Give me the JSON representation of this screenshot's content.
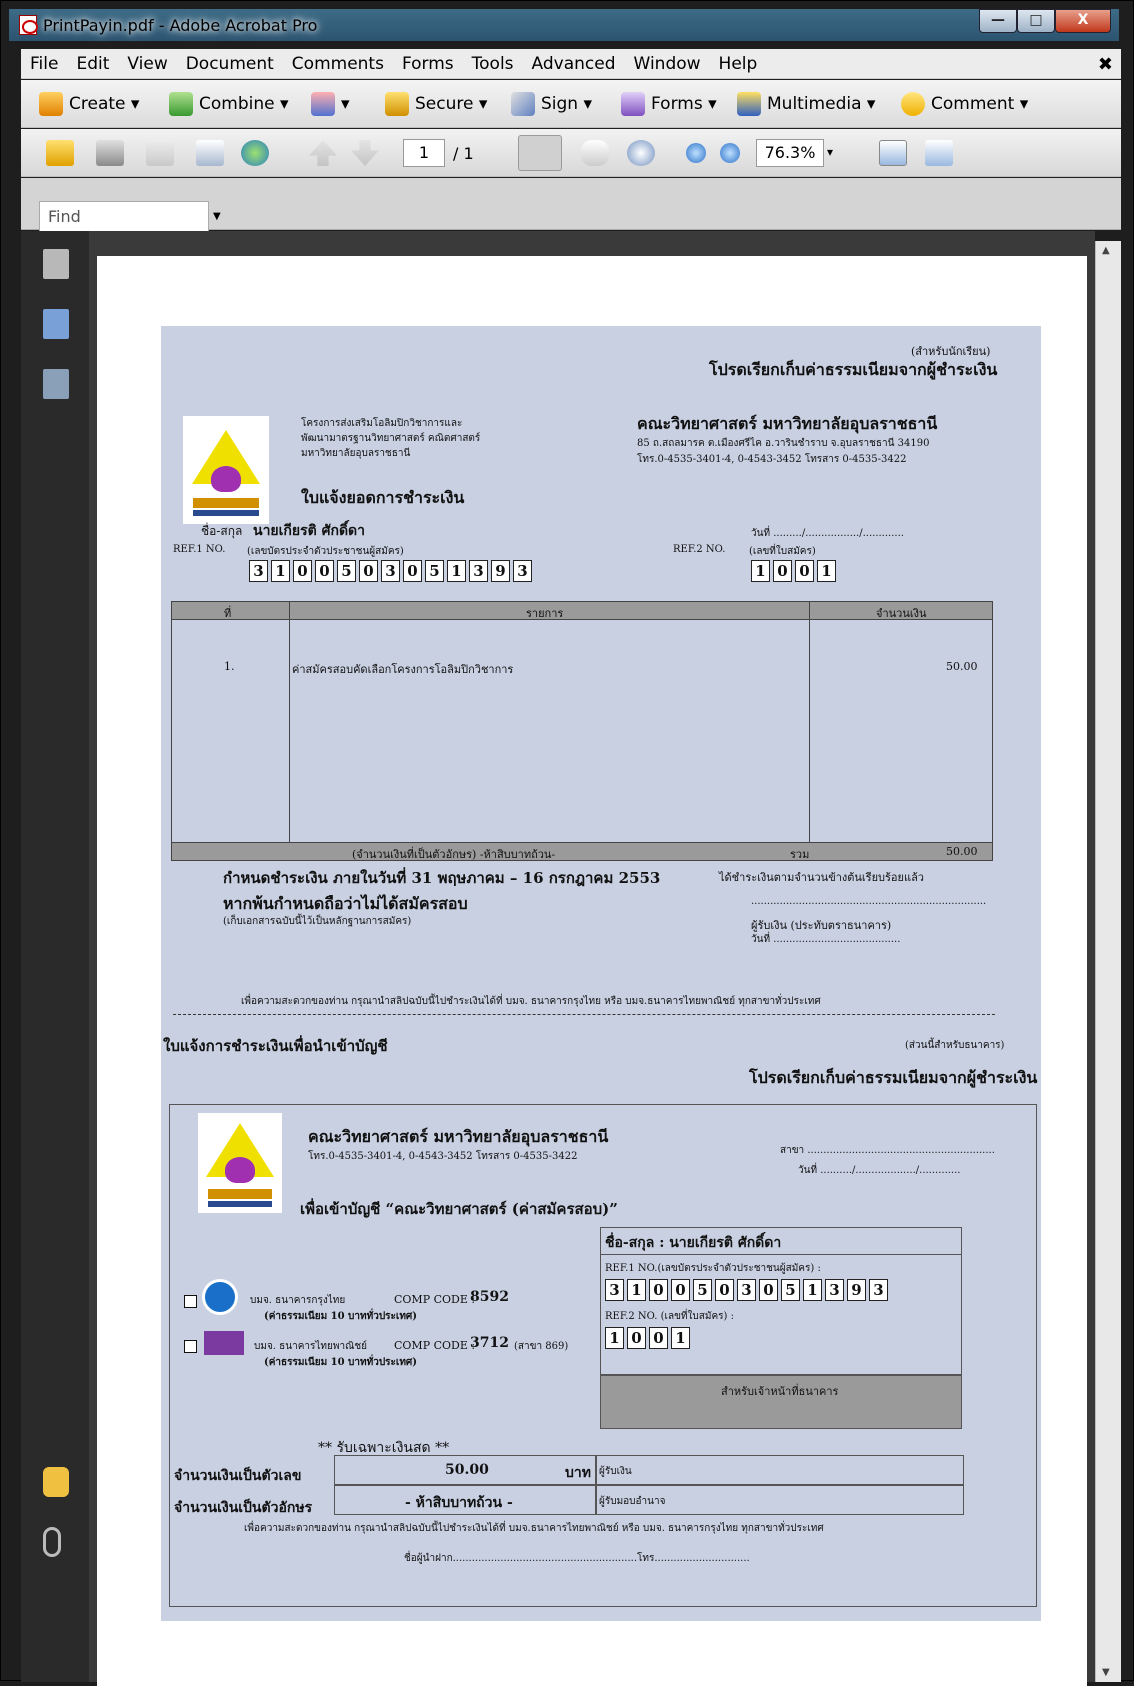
{
  "window": {
    "title": "PrintPayin.pdf - Adobe Acrobat Pro",
    "min_glyph": "—",
    "max_glyph": "□",
    "close_glyph": "X"
  },
  "menubar": {
    "items": [
      "File",
      "Edit",
      "View",
      "Document",
      "Comments",
      "Forms",
      "Tools",
      "Advanced",
      "Window",
      "Help"
    ],
    "close_glyph": "✖"
  },
  "toolbar1": {
    "create": "Create",
    "combine": "Combine",
    "secure": "Secure",
    "sign": "Sign",
    "forms": "Forms",
    "multimedia": "Multimedia",
    "comment": "Comment",
    "dropdown_glyph": "▾"
  },
  "toolbar2": {
    "page_current": "1",
    "page_total": "/ 1",
    "zoom": "76.3%",
    "zoom_dropdown": "▾"
  },
  "find": {
    "placeholder": "Find",
    "dropdown_glyph": "▼"
  },
  "scroll": {
    "up": "▲",
    "down": "▼"
  },
  "doc": {
    "top_copy_label": "(สำหรับนักเรียน)",
    "top_collect": "โปรดเรียกเก็บค่าธรรมเนียมจากผู้ชำระเงิน",
    "project_line1": "โครงการส่งเสริมโอลิมปิกวิชาการและ",
    "project_line2": "พัฒนามาตรฐานวิทยาศาสตร์ คณิตศาสตร์",
    "project_line3": "มหาวิทยาลัยอุบลราชธานี",
    "faculty": "คณะวิทยาศาสตร์ มหาวิทยาลัยอุบลราชธานี",
    "address": "85 ถ.สถลมารค ต.เมืองศรีไค อ.วารินชำราบ จ.อุบลราชธานี 34190",
    "phone": "โทร.0-4535-3401-4, 0-4543-3452 โทรสาร 0-4535-3422",
    "slip_title": "ใบแจ้งยอดการชำระเงิน",
    "name_label": "ชื่อ-สกุล",
    "name_value": "นายเกียรติ ศักดิ์ดา",
    "date_label": "วันที่ ........./................./.............",
    "ref1_label": "REF.1 NO.",
    "ref1_note": "(เลขบัตรประจำตัวประชาชนผู้สมัคร)",
    "ref2_label": "REF.2 NO.",
    "ref2_note": "(เลขที่ใบสมัคร)",
    "ref1_digits": [
      "3",
      "1",
      "0",
      "0",
      "5",
      "0",
      "3",
      "0",
      "5",
      "1",
      "3",
      "9",
      "3"
    ],
    "ref2_digits": [
      "1",
      "0",
      "0",
      "1"
    ],
    "table": {
      "headers": [
        "ที่",
        "รายการ",
        "จำนวนเงิน"
      ],
      "rows": [
        {
          "no": "1.",
          "item": "ค่าสมัครสอบคัดเลือกโครงการโอลิมปิกวิชาการ",
          "amount": "50.00"
        }
      ],
      "words_label": "(จำนวนเงินที่เป็นตัวอักษร) -ห้าสิบบาทถ้วน-",
      "total_label": "รวม",
      "total_value": "50.00"
    },
    "deadline": "กำหนดชำระเงิน ภายในวันที่ 31 พฤษภาคม – 16 กรกฎาคม 2553",
    "paid_note": "ได้ชำระเงินตามจำนวนข้างต้นเรียบร้อยแล้ว",
    "late_note": "หากพ้นกำหนดถือว่าไม่ได้สมัครสอบ",
    "keep_note": "(เก็บเอกสารฉบับนี้ไว้เป็นหลักฐานการสมัคร)",
    "sign_line": "..........................................................................",
    "receiver": "ผู้รับเงิน (ประทับตราธนาคาร)",
    "receiver_date": "วันที่ ........................................",
    "convenience_top": "เพื่อความสะดวกของท่าน กรุณานำสลิปฉบับนี้ไปชำระเงินได้ที่ บมจ. ธนาคารกรุงไทย หรือ บมจ.ธนาคารไทยพาณิชย์ ทุกสาขาทั่วประเทศ",
    "bank_slip_title": "ใบแจ้งการชำระเงินเพื่อนำเข้าบัญชี",
    "bank_copy_label": "(ส่วนนี้สำหรับธนาคาร)",
    "bank_collect": "โปรดเรียกเก็บค่าธรรมเนียมจากผู้ชำระเงิน",
    "branch_label": "สาขา ...........................................................",
    "bank_date": "วันที่ ........../.................../.............",
    "account_title": "เพื่อเข้าบัญชี “คณะวิทยาศาสตร์ (ค่าสมัครสอบ)”",
    "name_full": "ชื่อ-สกุล : นายเกียรติ ศักดิ์ดา",
    "ref1_full": "REF.1 NO.(เลขบัตรประจำตัวประชาชนผู้สมัคร) :",
    "ref2_full": "REF.2 NO. (เลขที่ใบสมัคร) :",
    "bank_officer": "สำหรับเจ้าหน้าที่ธนาคาร",
    "ktb_name": "บมจ. ธนาคารกรุงไทย",
    "ktb_code_label": "COMP CODE :",
    "ktb_code": "8592",
    "ktb_fee": "(ค่าธรรมเนียม 10 บาททั่วประเทศ)",
    "scb_name": "บมจ. ธนาคารไทยพาณิชย์",
    "scb_code_label": "COMP CODE :",
    "scb_code": "3712",
    "scb_branch": "(สาขา 869)",
    "scb_fee": "(ค่าธรรมเนียม 10 บาททั่วประเทศ)",
    "cash_only": "** รับเฉพาะเงินสด **",
    "amount_num_label": "จำนวนเงินเป็นตัวเลข",
    "amount_num": "50.00",
    "baht": "บาท",
    "payer_sig": "ผู้รับเงิน",
    "amount_text_label": "จำนวนเงินเป็นตัวอักษร",
    "amount_text": "- ห้าสิบบาทถ้วน -",
    "authorized": "ผู้รับมอบอำนาจ",
    "convenience_bottom": "เพื่อความสะดวกของท่าน กรุณานำสลิปฉบับนี้ไปชำระเงินได้ที่ บมจ.ธนาคารไทยพาณิชย์ หรือ บมจ. ธนาคารกรุงไทย ทุกสาขาทั่วประเทศ",
    "depositor": "ชื่อผู้นำฝาก..........................................................โทร..............................",
    "logo_caption": "มหาวิทยาลัยอุบลราชธานี"
  }
}
